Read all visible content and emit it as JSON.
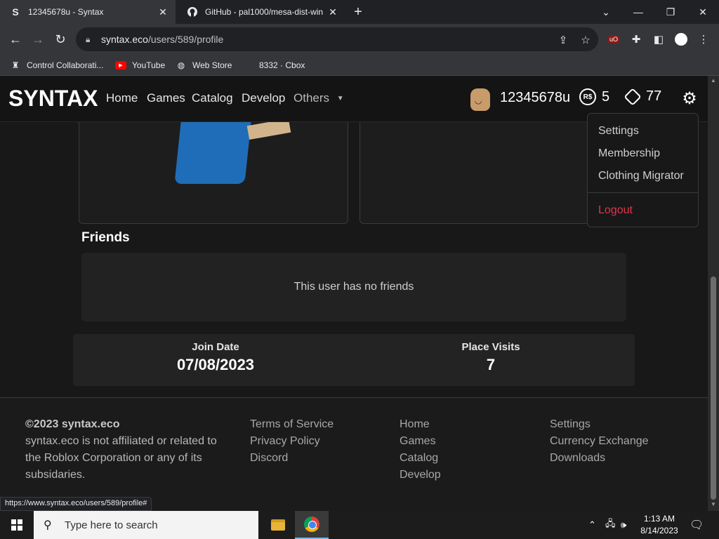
{
  "browser": {
    "tabs": [
      {
        "favicon": "S",
        "title": "12345678u - Syntax",
        "close": "✕"
      },
      {
        "favicon": "github-icon",
        "title": "GitHub - pal1000/mesa-dist-win",
        "close": "✕"
      }
    ],
    "new_tab": "+",
    "window_controls": {
      "minimize": "—",
      "restore": "❐",
      "close": "✕",
      "tablist": "⌄"
    },
    "url_host": "syntax.eco",
    "url_path": "/users/589/profile",
    "bookmarks": [
      {
        "icon": "control-collab-icon",
        "label": "Control Collaborati..."
      },
      {
        "icon": "youtube-icon",
        "label": "YouTube"
      },
      {
        "icon": "webstore-icon",
        "label": "Web Store"
      },
      {
        "icon": "cbox-icon",
        "label": "8332 · Cbox"
      }
    ],
    "status_url": "https://www.syntax.eco/users/589/profile#"
  },
  "site": {
    "brand": "SYNTAX",
    "nav": [
      "Home",
      "Games",
      "Catalog",
      "Develop"
    ],
    "others": "Others",
    "username": "12345678u",
    "robux_icon": "R$",
    "robux": "5",
    "tix": "77",
    "dropdown": {
      "items": [
        "Settings",
        "Membership",
        "Clothing Migrator"
      ],
      "logout": "Logout"
    }
  },
  "profile": {
    "friends_title": "Friends",
    "friends_empty": "This user has no friends",
    "join_date_label": "Join Date",
    "join_date": "07/08/2023",
    "place_visits_label": "Place Visits",
    "place_visits": "7"
  },
  "footer": {
    "copyright": "©2023 syntax.eco",
    "note": "syntax.eco is not affiliated or related to the Roblox Corporation or any of its subsidaries.",
    "legal_links": [
      "Terms of Service",
      "Privacy Policy",
      "Discord"
    ],
    "nav_links": [
      "Home",
      "Games",
      "Catalog",
      "Develop"
    ],
    "account_links": [
      "Settings",
      "Currency Exchange",
      "Downloads"
    ]
  },
  "taskbar": {
    "search_placeholder": "Type here to search",
    "time": "1:13 AM",
    "date": "8/14/2023"
  },
  "colors": {
    "accent_logout": "#e0344a",
    "page_bg": "#181818"
  }
}
